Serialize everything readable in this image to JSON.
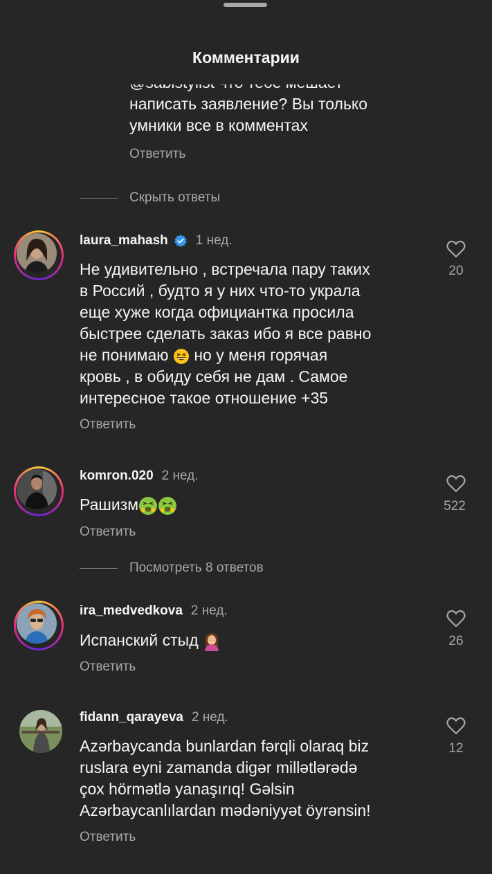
{
  "header": {
    "title": "Комментарии"
  },
  "top_reply": {
    "lines": [
      "@sabistylist что тебе мешает",
      "написать заявление? Вы только",
      "умники все в комментах"
    ],
    "reply_label": "Ответить"
  },
  "hide_replies_label": "Скрыть ответы",
  "comments": [
    {
      "username": "laura_mahash",
      "verified": true,
      "time": "1 нед.",
      "lines": [
        "Не удивительно , встречала  пару таких",
        "в Россий , будто я у них что-то украла",
        "еще хуже когда официантка просила",
        "быстрее сделать заказ ибо я все равно",
        "не понимаю ",
        " но у меня горячая",
        "кровь , в обиду себя не дам .  Самое",
        "интересное такое отношение +35"
      ],
      "likes": "20",
      "reply_label": "Ответить"
    },
    {
      "username": "komron.020",
      "time": "2 нед.",
      "text": "Рашизм",
      "likes": "522",
      "reply_label": "Ответить"
    },
    {
      "username": "ira_medvedkova",
      "time": "2 нед.",
      "text": "Испанский стыд ",
      "likes": "26",
      "reply_label": "Ответить"
    },
    {
      "username": "fidann_qarayeva",
      "time": "2 нед.",
      "lines": [
        "Azərbaycanda bunlardan fərqli olaraq biz",
        "ruslara eyni zamanda digər millətlərədə",
        "çox hörmətlə yanaşırıq! Gəlsin",
        "Azərbaycanlılardan mədəniyyət öyrənsin!"
      ],
      "likes": "12",
      "reply_label": "Ответить"
    }
  ],
  "view_replies_label": "Посмотреть 8 ответов",
  "icons": [
    "heart-outline-icon",
    "verified-badge-icon",
    "grinning-squinting-face-emoji",
    "nauseated-face-emoji",
    "woman-facepalming-emoji"
  ],
  "colors": {
    "background": "#262626",
    "text": "#f5f5f5",
    "secondary": "#a8a8a8",
    "verified": "#3797f0"
  }
}
